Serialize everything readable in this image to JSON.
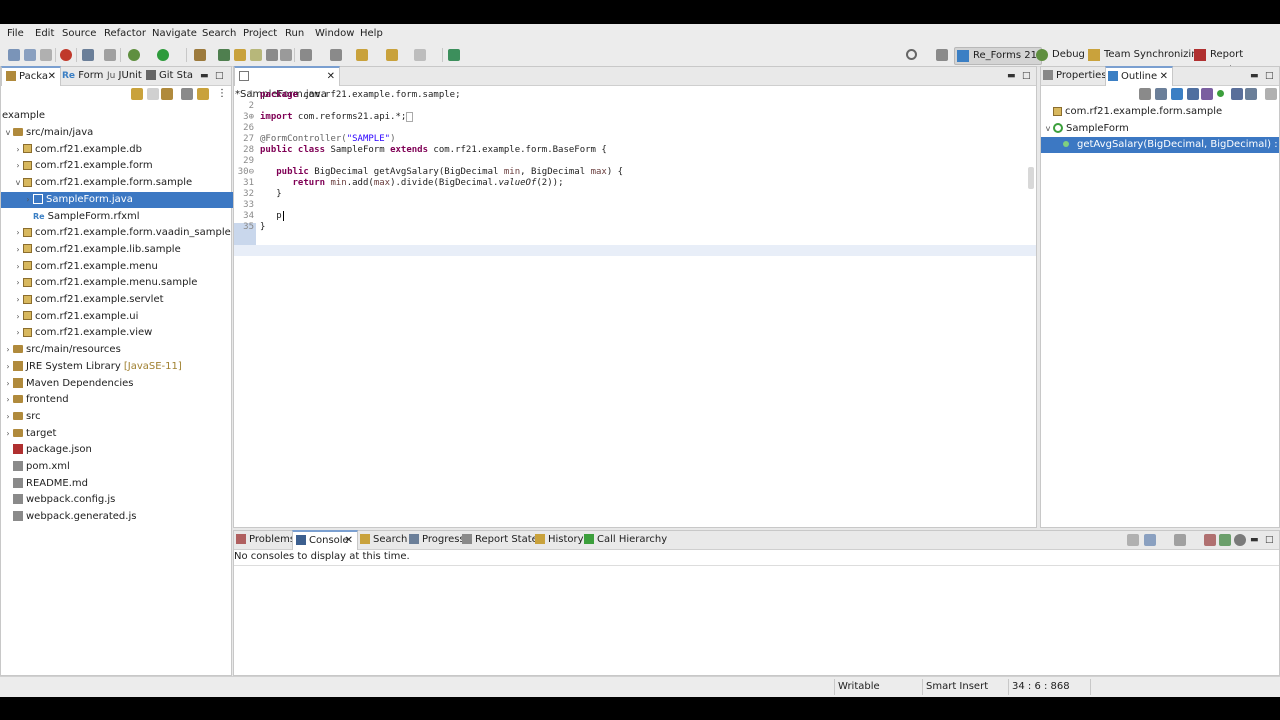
{
  "menu": [
    "File",
    "Edit",
    "Source",
    "Refactor",
    "Navigate",
    "Search",
    "Project",
    "Run",
    "Window",
    "Help"
  ],
  "perspectives": [
    {
      "label": "Re_Forms 21",
      "active": true
    },
    {
      "label": "Debug",
      "active": false
    },
    {
      "label": "Team Synchronizing",
      "active": false
    },
    {
      "label": "Report Design",
      "active": false
    }
  ],
  "left_tabs": [
    "Packa",
    "Form",
    "JUnit",
    "Git Sta"
  ],
  "tree": {
    "root": "example",
    "items": [
      {
        "label": "src/main/java",
        "level": 0,
        "tw": "v",
        "kind": "folder"
      },
      {
        "label": "com.rf21.example.db",
        "level": 1,
        "tw": ">",
        "kind": "pkg"
      },
      {
        "label": "com.rf21.example.form",
        "level": 1,
        "tw": ">",
        "kind": "pkg"
      },
      {
        "label": "com.rf21.example.form.sample",
        "level": 1,
        "tw": "v",
        "kind": "pkg"
      },
      {
        "label": "SampleForm.java",
        "level": 2,
        "tw": ">",
        "kind": "java",
        "selected": true
      },
      {
        "label": "SampleForm.rfxml",
        "level": 2,
        "tw": "",
        "kind": "rfxml"
      },
      {
        "label": "com.rf21.example.form.vaadin_sample",
        "level": 1,
        "tw": ">",
        "kind": "pkg"
      },
      {
        "label": "com.rf21.example.lib.sample",
        "level": 1,
        "tw": ">",
        "kind": "pkg"
      },
      {
        "label": "com.rf21.example.menu",
        "level": 1,
        "tw": ">",
        "kind": "pkg"
      },
      {
        "label": "com.rf21.example.menu.sample",
        "level": 1,
        "tw": ">",
        "kind": "pkg"
      },
      {
        "label": "com.rf21.example.servlet",
        "level": 1,
        "tw": ">",
        "kind": "pkg"
      },
      {
        "label": "com.rf21.example.ui",
        "level": 1,
        "tw": ">",
        "kind": "pkg"
      },
      {
        "label": "com.rf21.example.view",
        "level": 1,
        "tw": ">",
        "kind": "pkg"
      },
      {
        "label": "src/main/resources",
        "level": 0,
        "tw": ">",
        "kind": "folder"
      },
      {
        "label": "JRE System Library",
        "suffix": "[JavaSE-11]",
        "level": 0,
        "tw": ">",
        "kind": "lib"
      },
      {
        "label": "Maven Dependencies",
        "level": 0,
        "tw": ">",
        "kind": "lib"
      },
      {
        "label": "frontend",
        "level": 0,
        "tw": ">",
        "kind": "folder"
      },
      {
        "label": "src",
        "level": 0,
        "tw": ">",
        "kind": "folder"
      },
      {
        "label": "target",
        "level": 0,
        "tw": ">",
        "kind": "folder"
      },
      {
        "label": "package.json",
        "level": 0,
        "tw": "",
        "kind": "json"
      },
      {
        "label": "pom.xml",
        "level": 0,
        "tw": "",
        "kind": "file"
      },
      {
        "label": "README.md",
        "level": 0,
        "tw": "",
        "kind": "file"
      },
      {
        "label": "webpack.config.js",
        "level": 0,
        "tw": "",
        "kind": "file"
      },
      {
        "label": "webpack.generated.js",
        "level": 0,
        "tw": "",
        "kind": "file"
      }
    ]
  },
  "editor": {
    "tab": "*SampleForm.java",
    "lines": [
      {
        "n": "1",
        "code": "package com.rf21.example.form.sample;"
      },
      {
        "n": "2",
        "code": ""
      },
      {
        "n": "3⊕",
        "code": "import com.reforms21.api.*;□"
      },
      {
        "n": "26",
        "code": ""
      },
      {
        "n": "27",
        "code": "@FormController(\"SAMPLE\")"
      },
      {
        "n": "28",
        "code": "public class SampleForm extends com.rf21.example.form.BaseForm {"
      },
      {
        "n": "29",
        "code": ""
      },
      {
        "n": "30⊖",
        "code": "    public BigDecimal getAvgSalary(BigDecimal min, BigDecimal max) {"
      },
      {
        "n": "31",
        "code": "        return min.add(max).divide(BigDecimal.valueOf(2));"
      },
      {
        "n": "32",
        "code": "    }"
      },
      {
        "n": "33",
        "code": ""
      },
      {
        "n": "34",
        "code": "    p"
      },
      {
        "n": "35",
        "code": "}"
      }
    ]
  },
  "right_tabs": [
    "Properties",
    "Outline"
  ],
  "outline": {
    "package": "com.rf21.example.form.sample",
    "class": "SampleForm",
    "method": "getAvgSalary(BigDecimal, BigDecimal) : BigDecim"
  },
  "bottom_tabs": [
    "Problems",
    "Console",
    "Search",
    "Progress",
    "Report State",
    "History",
    "Call Hierarchy"
  ],
  "console_message": "No consoles to display at this time.",
  "status": {
    "writable": "Writable",
    "insert": "Smart Insert",
    "position": "34 : 6 : 868"
  }
}
